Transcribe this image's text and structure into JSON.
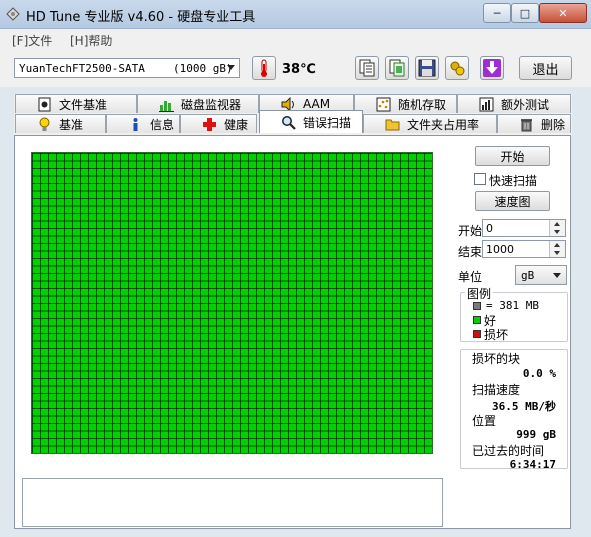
{
  "window": {
    "title": "HD Tune 专业版 v4.60 - 硬盘专业工具",
    "minimize": "─",
    "maximize": "□",
    "close": "✕"
  },
  "menu": [
    {
      "label": "[F]文件"
    },
    {
      "label": "[H]帮助"
    }
  ],
  "toolbar": {
    "drive_name": "YuanTechFT2500-SATA",
    "drive_size": "(1000 gB)",
    "temperature": "38℃",
    "exit_label": "退出"
  },
  "tabs_row1": [
    {
      "label": "文件基准",
      "icon": "file-benchmark-icon"
    },
    {
      "label": "磁盘监视器",
      "icon": "disk-monitor-icon"
    },
    {
      "label": "AAM",
      "icon": "speaker-icon"
    },
    {
      "label": "随机存取",
      "icon": "random-access-icon"
    },
    {
      "label": "额外测试",
      "icon": "extra-tests-icon"
    }
  ],
  "tabs_row2": [
    {
      "label": "基准",
      "icon": "benchmark-icon"
    },
    {
      "label": "信息",
      "icon": "info-icon"
    },
    {
      "label": "健康",
      "icon": "health-icon"
    },
    {
      "label": "错误扫描",
      "icon": "magnifier-icon",
      "active": true
    },
    {
      "label": "文件夹占用率",
      "icon": "folder-icon"
    },
    {
      "label": "删除",
      "icon": "trash-icon"
    }
  ],
  "scan": {
    "start_button": "开始",
    "quick_scan_label": "快速扫描",
    "quick_scan_checked": false,
    "speed_map_button": "速度图",
    "start_label": "开始",
    "start_value": "0",
    "end_label": "结束",
    "end_value": "1000",
    "unit_label": "单位",
    "unit_value": "gB",
    "legend_title": "图例",
    "legend_block": "= 381 MB",
    "legend_good": "好",
    "legend_bad": "损坏",
    "block_status": "all-good"
  },
  "stats": {
    "damaged_label": "损坏的块",
    "damaged_value": "0.0 %",
    "speed_label": "扫描速度",
    "speed_value": "36.5 MB/秒",
    "position_label": "位置",
    "position_value": "999 gB",
    "elapsed_label": "已过去的时间",
    "elapsed_value": "6:34:17"
  },
  "colors": {
    "good": "#00d200",
    "bad": "#d01010",
    "block_legend": "#7a7a7a",
    "gridline": "#0b4d0b"
  }
}
